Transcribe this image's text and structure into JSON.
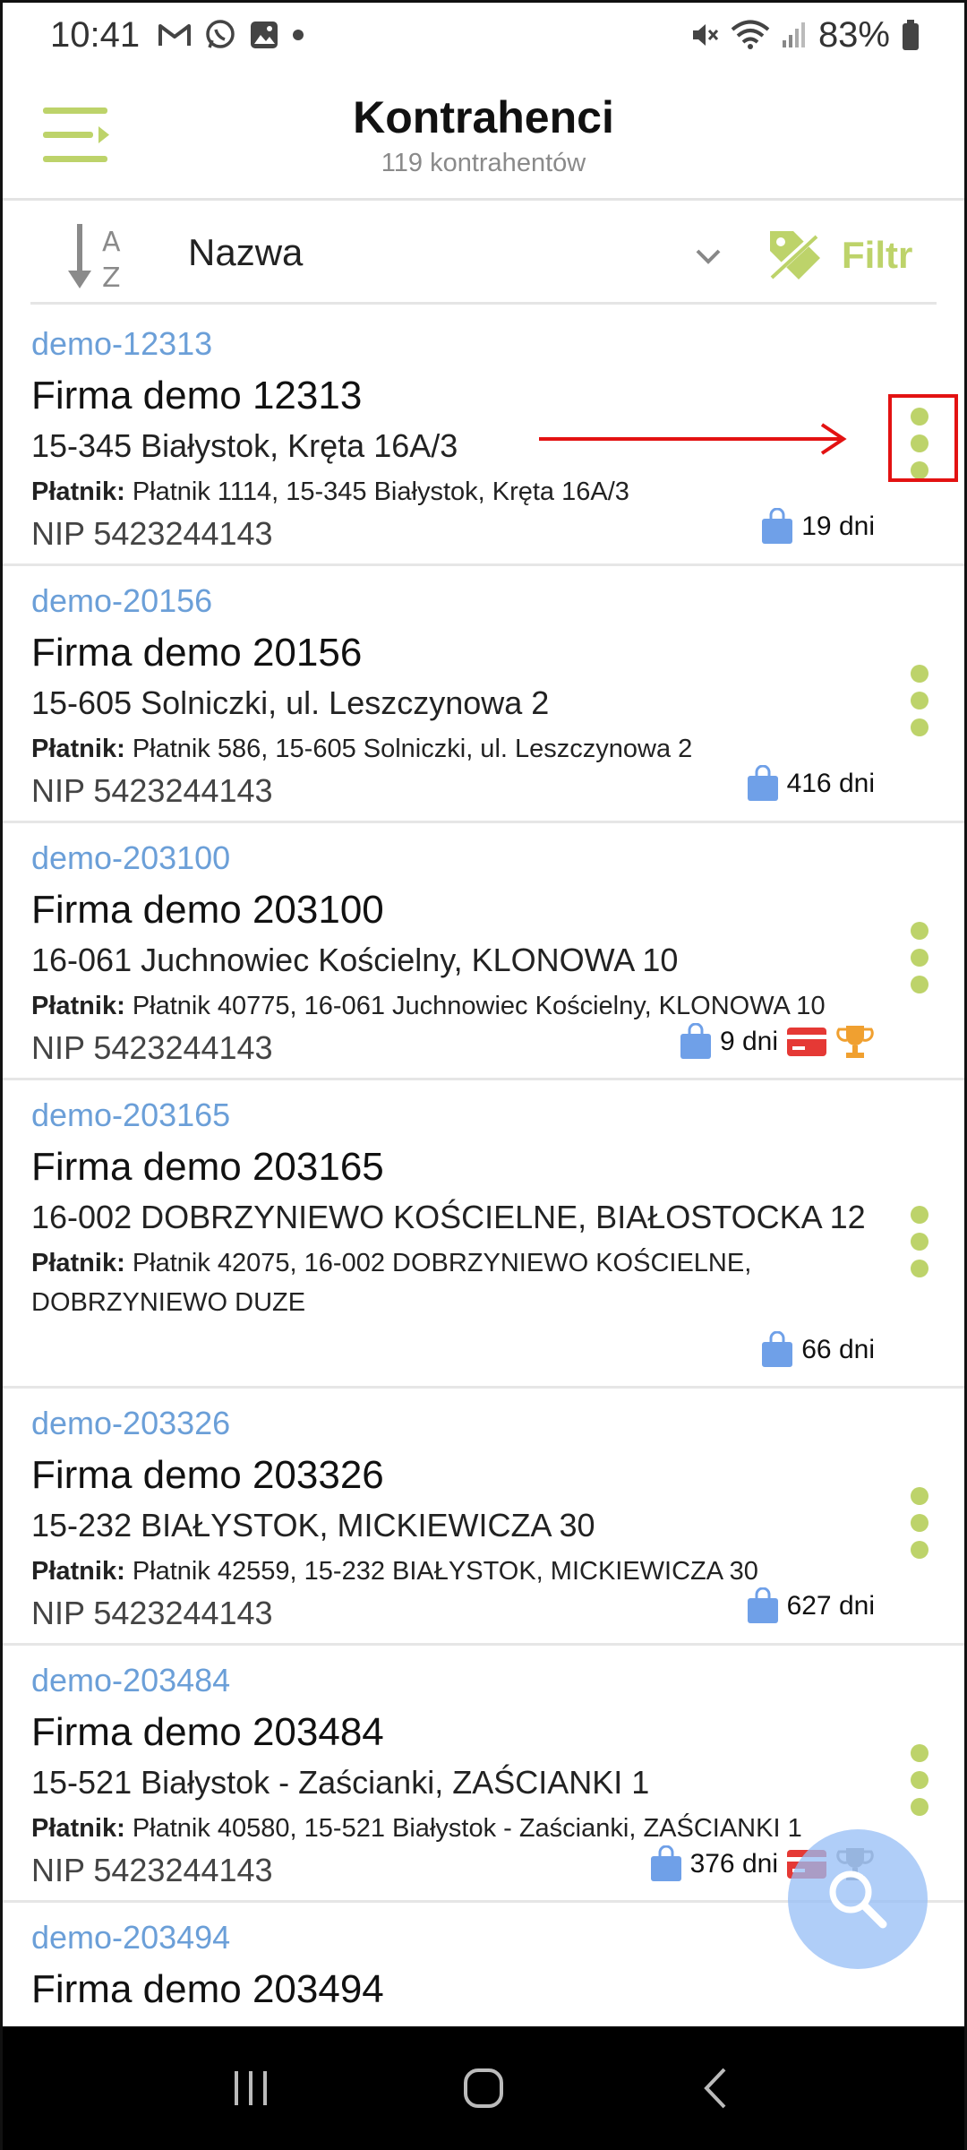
{
  "status_bar": {
    "time": "10:41",
    "battery": "83%",
    "notification_icons": [
      "gmail-icon",
      "whatsapp-icon",
      "gallery-icon",
      "dot-icon"
    ],
    "system_icons": [
      "mute-icon",
      "wifi-icon",
      "signal-icon",
      "battery-icon"
    ]
  },
  "header": {
    "title": "Kontrahenci",
    "subtitle": "119 kontrahentów",
    "menu_icon": "menu-icon"
  },
  "toolbar": {
    "sort_label": "Nazwa",
    "filter_label": "Filtr",
    "sort_icon": "sort-az-icon",
    "filter_icon": "tag-off-icon"
  },
  "payer_label": "Płatnik:",
  "contractors": [
    {
      "code": "demo-12313",
      "name": "Firma demo 12313",
      "address": "15-345 Białystok, Kręta 16A/3",
      "payer": "Płatnik 1114, 15-345 Białystok, Kręta 16A/3",
      "nip": "NIP 5423244143",
      "days": "19 dni",
      "card": false,
      "trophy": false
    },
    {
      "code": "demo-20156",
      "name": "Firma demo 20156",
      "address": "15-605 Solniczki, ul. Leszczynowa 2",
      "payer": "Płatnik 586, 15-605 Solniczki, ul. Leszczynowa 2",
      "nip": "NIP 5423244143",
      "days": "416 dni",
      "card": false,
      "trophy": false
    },
    {
      "code": "demo-203100",
      "name": "Firma demo 203100",
      "address": "16-061 Juchnowiec Kościelny, KLONOWA 10",
      "payer": "Płatnik 40775, 16-061 Juchnowiec Kościelny, KLONOWA 10",
      "nip": "NIP 5423244143",
      "days": "9 dni",
      "card": true,
      "trophy": true
    },
    {
      "code": "demo-203165",
      "name": "Firma demo 203165",
      "address": "16-002 DOBRZYNIEWO KOŚCIELNE, BIAŁOSTOCKA 12",
      "payer": "Płatnik 42075, 16-002 DOBRZYNIEWO KOŚCIELNE, DOBRZYNIEWO DUZE",
      "nip": "",
      "days": "66 dni",
      "card": false,
      "trophy": false
    },
    {
      "code": "demo-203326",
      "name": "Firma demo 203326",
      "address": "15-232 BIAŁYSTOK, MICKIEWICZA 30",
      "payer": "Płatnik 42559, 15-232 BIAŁYSTOK, MICKIEWICZA 30",
      "nip": "NIP 5423244143",
      "days": "627 dni",
      "card": false,
      "trophy": false
    },
    {
      "code": "demo-203484",
      "name": "Firma demo 203484",
      "address": "15-521 Białystok - Zaścianki, ZAŚCIANKI 1",
      "payer": "Płatnik 40580, 15-521 Białystok - Zaścianki, ZAŚCIANKI 1",
      "nip": "NIP 5423244143",
      "days": "376 dni",
      "card": true,
      "trophy": true
    },
    {
      "code": "demo-203494",
      "name": "Firma demo 203494",
      "address": "",
      "payer": "",
      "nip": "",
      "days": "",
      "card": false,
      "trophy": false
    }
  ],
  "colors": {
    "accent": "#bdd36a",
    "code_blue": "#6b9fd8",
    "bag_blue": "#6fa0e8",
    "card_red": "#e53935",
    "trophy_orange": "#f0a030",
    "annotation_red": "#e31212"
  },
  "fab_icon": "search-icon",
  "navbar_icons": [
    "recents-icon",
    "home-icon",
    "back-icon"
  ]
}
